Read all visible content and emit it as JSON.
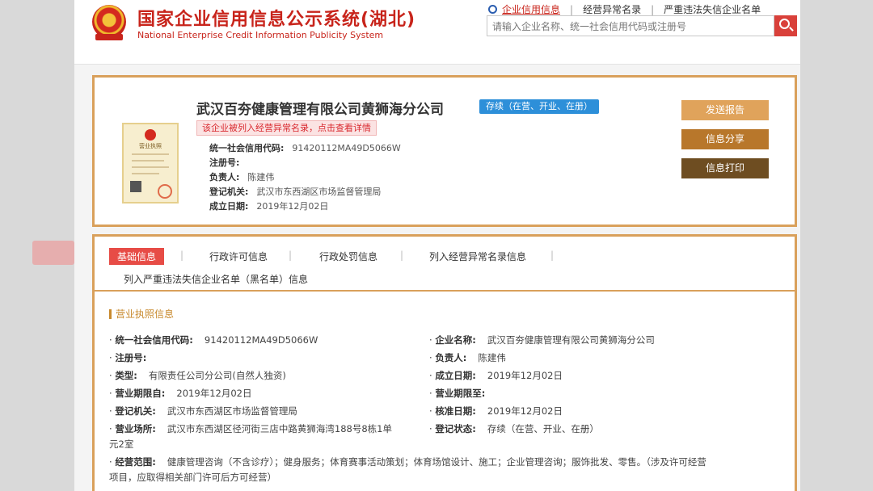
{
  "header": {
    "site_title": "国家企业信用信息公示系统(湖北)",
    "site_subtitle": "National Enterprise Credit Information Publicity System",
    "links": [
      "企业信用信息",
      "经营异常名录",
      "严重违法失信企业名单"
    ],
    "search_placeholder": "请输入企业名称、统一社会信用代码或注册号"
  },
  "company": {
    "name": "武汉百夯健康管理有限公司黄狮海分公司",
    "status": "存续（在营、开业、在册）",
    "warning": "该企业被列入经营异常名录，点击查看详情",
    "license_label": "营业执照",
    "fields": [
      {
        "label": "统一社会信用代码:",
        "value": "91420112MA49D5066W"
      },
      {
        "label": "注册号:",
        "value": ""
      },
      {
        "label": "负责人:",
        "value": "陈建伟"
      },
      {
        "label": "登记机关:",
        "value": "武汉市东西湖区市场监督管理局"
      },
      {
        "label": "成立日期:",
        "value": "2019年12月02日"
      }
    ]
  },
  "actions": {
    "report": "发送报告",
    "share": "信息分享",
    "print": "信息打印"
  },
  "tabs": [
    "基础信息",
    "行政许可信息",
    "行政处罚信息",
    "列入经营异常名录信息",
    "列入严重违法失信企业名单（黑名单）信息"
  ],
  "section": {
    "title": "营业执照信息",
    "left": [
      {
        "label": "统一社会信用代码:",
        "value": "91420112MA49D5066W"
      },
      {
        "label": "注册号:",
        "value": ""
      },
      {
        "label": "类型:",
        "value": "有限责任公司分公司(自然人独资)"
      },
      {
        "label": "营业期限自:",
        "value": "2019年12月02日"
      },
      {
        "label": "登记机关:",
        "value": "武汉市东西湖区市场监督管理局"
      },
      {
        "label": "营业场所:",
        "value": "武汉市东西湖区径河街三店中路黄狮海湾188号8栋1单"
      }
    ],
    "address_cont": "元2室",
    "right": [
      {
        "label": "企业名称:",
        "value": "武汉百夯健康管理有限公司黄狮海分公司"
      },
      {
        "label": "负责人:",
        "value": "陈建伟"
      },
      {
        "label": "成立日期:",
        "value": "2019年12月02日"
      },
      {
        "label": "营业期限至:",
        "value": ""
      },
      {
        "label": "核准日期:",
        "value": "2019年12月02日"
      },
      {
        "label": "登记状态:",
        "value": "存续（在营、开业、在册）"
      }
    ],
    "scope_label": "经营范围:",
    "scope_line1": "健康管理咨询（不含诊疗）；健身服务；体育赛事活动策划；体育场馆设计、施工；企业管理咨询；服饰批发、零售。（涉及许可经营",
    "scope_line2": "项目，应取得相关部门许可后方可经营）"
  }
}
